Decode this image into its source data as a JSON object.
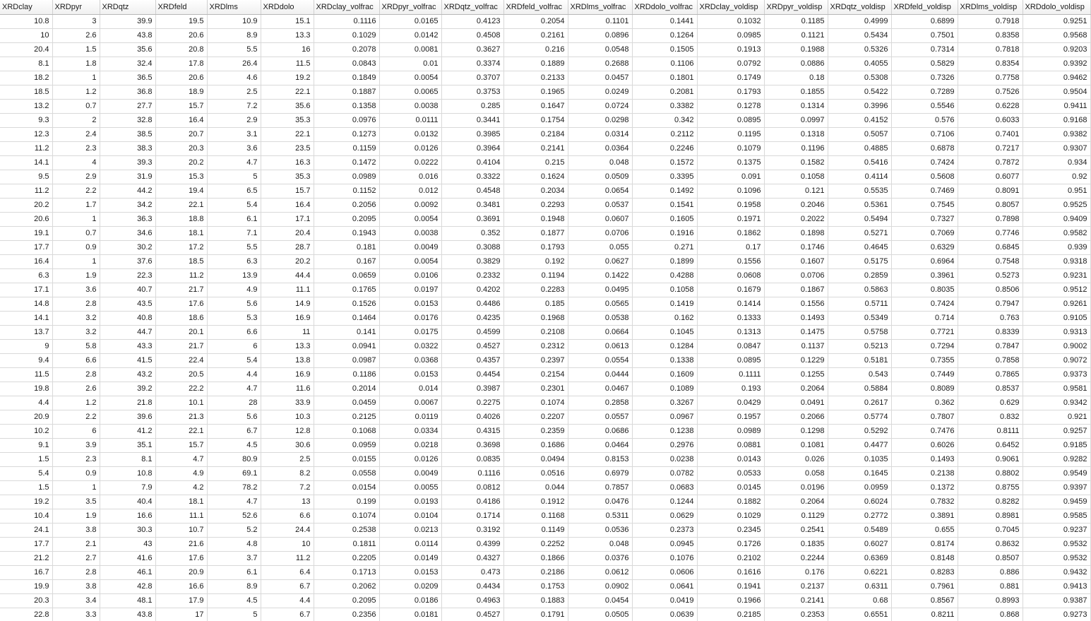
{
  "columns": [
    "XRDclay",
    "XRDpyr",
    "XRDqtz",
    "XRDfeld",
    "XRDlms",
    "XRDdolo",
    "XRDclay_volfrac",
    "XRDpyr_volfrac",
    "XRDqtz_volfrac",
    "XRDfeld_volfrac",
    "XRDlms_volfrac",
    "XRDdolo_volfrac",
    "XRDclay_voldisp",
    "XRDpyr_voldisp",
    "XRDqtz_voldisp",
    "XRDfeld_voldisp",
    "XRDlms_voldisp",
    "XRDdolo_voldisp"
  ],
  "rows": [
    [
      "10.8",
      "3",
      "39.9",
      "19.5",
      "10.9",
      "15.1",
      "0.1116",
      "0.0165",
      "0.4123",
      "0.2054",
      "0.1101",
      "0.1441",
      "0.1032",
      "0.1185",
      "0.4999",
      "0.6899",
      "0.7918",
      "0.9251"
    ],
    [
      "10",
      "2.6",
      "43.8",
      "20.6",
      "8.9",
      "13.3",
      "0.1029",
      "0.0142",
      "0.4508",
      "0.2161",
      "0.0896",
      "0.1264",
      "0.0985",
      "0.1121",
      "0.5434",
      "0.7501",
      "0.8358",
      "0.9568"
    ],
    [
      "20.4",
      "1.5",
      "35.6",
      "20.8",
      "5.5",
      "16",
      "0.2078",
      "0.0081",
      "0.3627",
      "0.216",
      "0.0548",
      "0.1505",
      "0.1913",
      "0.1988",
      "0.5326",
      "0.7314",
      "0.7818",
      "0.9203"
    ],
    [
      "8.1",
      "1.8",
      "32.4",
      "17.8",
      "26.4",
      "11.5",
      "0.0843",
      "0.01",
      "0.3374",
      "0.1889",
      "0.2688",
      "0.1106",
      "0.0792",
      "0.0886",
      "0.4055",
      "0.5829",
      "0.8354",
      "0.9392"
    ],
    [
      "18.2",
      "1",
      "36.5",
      "20.6",
      "4.6",
      "19.2",
      "0.1849",
      "0.0054",
      "0.3707",
      "0.2133",
      "0.0457",
      "0.1801",
      "0.1749",
      "0.18",
      "0.5308",
      "0.7326",
      "0.7758",
      "0.9462"
    ],
    [
      "18.5",
      "1.2",
      "36.8",
      "18.9",
      "2.5",
      "22.1",
      "0.1887",
      "0.0065",
      "0.3753",
      "0.1965",
      "0.0249",
      "0.2081",
      "0.1793",
      "0.1855",
      "0.5422",
      "0.7289",
      "0.7526",
      "0.9504"
    ],
    [
      "13.2",
      "0.7",
      "27.7",
      "15.7",
      "7.2",
      "35.6",
      "0.1358",
      "0.0038",
      "0.285",
      "0.1647",
      "0.0724",
      "0.3382",
      "0.1278",
      "0.1314",
      "0.3996",
      "0.5546",
      "0.6228",
      "0.9411"
    ],
    [
      "9.3",
      "2",
      "32.8",
      "16.4",
      "2.9",
      "35.3",
      "0.0976",
      "0.0111",
      "0.3441",
      "0.1754",
      "0.0298",
      "0.342",
      "0.0895",
      "0.0997",
      "0.4152",
      "0.576",
      "0.6033",
      "0.9168"
    ],
    [
      "12.3",
      "2.4",
      "38.5",
      "20.7",
      "3.1",
      "22.1",
      "0.1273",
      "0.0132",
      "0.3985",
      "0.2184",
      "0.0314",
      "0.2112",
      "0.1195",
      "0.1318",
      "0.5057",
      "0.7106",
      "0.7401",
      "0.9382"
    ],
    [
      "11.2",
      "2.3",
      "38.3",
      "20.3",
      "3.6",
      "23.5",
      "0.1159",
      "0.0126",
      "0.3964",
      "0.2141",
      "0.0364",
      "0.2246",
      "0.1079",
      "0.1196",
      "0.4885",
      "0.6878",
      "0.7217",
      "0.9307"
    ],
    [
      "14.1",
      "4",
      "39.3",
      "20.2",
      "4.7",
      "16.3",
      "0.1472",
      "0.0222",
      "0.4104",
      "0.215",
      "0.048",
      "0.1572",
      "0.1375",
      "0.1582",
      "0.5416",
      "0.7424",
      "0.7872",
      "0.934"
    ],
    [
      "9.5",
      "2.9",
      "31.9",
      "15.3",
      "5",
      "35.3",
      "0.0989",
      "0.016",
      "0.3322",
      "0.1624",
      "0.0509",
      "0.3395",
      "0.091",
      "0.1058",
      "0.4114",
      "0.5608",
      "0.6077",
      "0.92"
    ],
    [
      "11.2",
      "2.2",
      "44.2",
      "19.4",
      "6.5",
      "15.7",
      "0.1152",
      "0.012",
      "0.4548",
      "0.2034",
      "0.0654",
      "0.1492",
      "0.1096",
      "0.121",
      "0.5535",
      "0.7469",
      "0.8091",
      "0.951"
    ],
    [
      "20.2",
      "1.7",
      "34.2",
      "22.1",
      "5.4",
      "16.4",
      "0.2056",
      "0.0092",
      "0.3481",
      "0.2293",
      "0.0537",
      "0.1541",
      "0.1958",
      "0.2046",
      "0.5361",
      "0.7545",
      "0.8057",
      "0.9525"
    ],
    [
      "20.6",
      "1",
      "36.3",
      "18.8",
      "6.1",
      "17.1",
      "0.2095",
      "0.0054",
      "0.3691",
      "0.1948",
      "0.0607",
      "0.1605",
      "0.1971",
      "0.2022",
      "0.5494",
      "0.7327",
      "0.7898",
      "0.9409"
    ],
    [
      "19.1",
      "0.7",
      "34.6",
      "18.1",
      "7.1",
      "20.4",
      "0.1943",
      "0.0038",
      "0.352",
      "0.1877",
      "0.0706",
      "0.1916",
      "0.1862",
      "0.1898",
      "0.5271",
      "0.7069",
      "0.7746",
      "0.9582"
    ],
    [
      "17.7",
      "0.9",
      "30.2",
      "17.2",
      "5.5",
      "28.7",
      "0.181",
      "0.0049",
      "0.3088",
      "0.1793",
      "0.055",
      "0.271",
      "0.17",
      "0.1746",
      "0.4645",
      "0.6329",
      "0.6845",
      "0.939"
    ],
    [
      "16.4",
      "1",
      "37.6",
      "18.5",
      "6.3",
      "20.2",
      "0.167",
      "0.0054",
      "0.3829",
      "0.192",
      "0.0627",
      "0.1899",
      "0.1556",
      "0.1607",
      "0.5175",
      "0.6964",
      "0.7548",
      "0.9318"
    ],
    [
      "6.3",
      "1.9",
      "22.3",
      "11.2",
      "13.9",
      "44.4",
      "0.0659",
      "0.0106",
      "0.2332",
      "0.1194",
      "0.1422",
      "0.4288",
      "0.0608",
      "0.0706",
      "0.2859",
      "0.3961",
      "0.5273",
      "0.9231"
    ],
    [
      "17.1",
      "3.6",
      "40.7",
      "21.7",
      "4.9",
      "11.1",
      "0.1765",
      "0.0197",
      "0.4202",
      "0.2283",
      "0.0495",
      "0.1058",
      "0.1679",
      "0.1867",
      "0.5863",
      "0.8035",
      "0.8506",
      "0.9512"
    ],
    [
      "14.8",
      "2.8",
      "43.5",
      "17.6",
      "5.6",
      "14.9",
      "0.1526",
      "0.0153",
      "0.4486",
      "0.185",
      "0.0565",
      "0.1419",
      "0.1414",
      "0.1556",
      "0.5711",
      "0.7424",
      "0.7947",
      "0.9261"
    ],
    [
      "14.1",
      "3.2",
      "40.8",
      "18.6",
      "5.3",
      "16.9",
      "0.1464",
      "0.0176",
      "0.4235",
      "0.1968",
      "0.0538",
      "0.162",
      "0.1333",
      "0.1493",
      "0.5349",
      "0.714",
      "0.763",
      "0.9105"
    ],
    [
      "13.7",
      "3.2",
      "44.7",
      "20.1",
      "6.6",
      "11",
      "0.141",
      "0.0175",
      "0.4599",
      "0.2108",
      "0.0664",
      "0.1045",
      "0.1313",
      "0.1475",
      "0.5758",
      "0.7721",
      "0.8339",
      "0.9313"
    ],
    [
      "9",
      "5.8",
      "43.3",
      "21.7",
      "6",
      "13.3",
      "0.0941",
      "0.0322",
      "0.4527",
      "0.2312",
      "0.0613",
      "0.1284",
      "0.0847",
      "0.1137",
      "0.5213",
      "0.7294",
      "0.7847",
      "0.9002"
    ],
    [
      "9.4",
      "6.6",
      "41.5",
      "22.4",
      "5.4",
      "13.8",
      "0.0987",
      "0.0368",
      "0.4357",
      "0.2397",
      "0.0554",
      "0.1338",
      "0.0895",
      "0.1229",
      "0.5181",
      "0.7355",
      "0.7858",
      "0.9072"
    ],
    [
      "11.5",
      "2.8",
      "43.2",
      "20.5",
      "4.4",
      "16.9",
      "0.1186",
      "0.0153",
      "0.4454",
      "0.2154",
      "0.0444",
      "0.1609",
      "0.1111",
      "0.1255",
      "0.543",
      "0.7449",
      "0.7865",
      "0.9373"
    ],
    [
      "19.8",
      "2.6",
      "39.2",
      "22.2",
      "4.7",
      "11.6",
      "0.2014",
      "0.014",
      "0.3987",
      "0.2301",
      "0.0467",
      "0.1089",
      "0.193",
      "0.2064",
      "0.5884",
      "0.8089",
      "0.8537",
      "0.9581"
    ],
    [
      "4.4",
      "1.2",
      "21.8",
      "10.1",
      "28",
      "33.9",
      "0.0459",
      "0.0067",
      "0.2275",
      "0.1074",
      "0.2858",
      "0.3267",
      "0.0429",
      "0.0491",
      "0.2617",
      "0.362",
      "0.629",
      "0.9342"
    ],
    [
      "20.9",
      "2.2",
      "39.6",
      "21.3",
      "5.6",
      "10.3",
      "0.2125",
      "0.0119",
      "0.4026",
      "0.2207",
      "0.0557",
      "0.0967",
      "0.1957",
      "0.2066",
      "0.5774",
      "0.7807",
      "0.832",
      "0.921"
    ],
    [
      "10.2",
      "6",
      "41.2",
      "22.1",
      "6.7",
      "12.8",
      "0.1068",
      "0.0334",
      "0.4315",
      "0.2359",
      "0.0686",
      "0.1238",
      "0.0989",
      "0.1298",
      "0.5292",
      "0.7476",
      "0.8111",
      "0.9257"
    ],
    [
      "9.1",
      "3.9",
      "35.1",
      "15.7",
      "4.5",
      "30.6",
      "0.0959",
      "0.0218",
      "0.3698",
      "0.1686",
      "0.0464",
      "0.2976",
      "0.0881",
      "0.1081",
      "0.4477",
      "0.6026",
      "0.6452",
      "0.9185"
    ],
    [
      "1.5",
      "2.3",
      "8.1",
      "4.7",
      "80.9",
      "2.5",
      "0.0155",
      "0.0126",
      "0.0835",
      "0.0494",
      "0.8153",
      "0.0238",
      "0.0143",
      "0.026",
      "0.1035",
      "0.1493",
      "0.9061",
      "0.9282"
    ],
    [
      "5.4",
      "0.9",
      "10.8",
      "4.9",
      "69.1",
      "8.2",
      "0.0558",
      "0.0049",
      "0.1116",
      "0.0516",
      "0.6979",
      "0.0782",
      "0.0533",
      "0.058",
      "0.1645",
      "0.2138",
      "0.8802",
      "0.9549"
    ],
    [
      "1.5",
      "1",
      "7.9",
      "4.2",
      "78.2",
      "7.2",
      "0.0154",
      "0.0055",
      "0.0812",
      "0.044",
      "0.7857",
      "0.0683",
      "0.0145",
      "0.0196",
      "0.0959",
      "0.1372",
      "0.8755",
      "0.9397"
    ],
    [
      "19.2",
      "3.5",
      "40.4",
      "18.1",
      "4.7",
      "13",
      "0.199",
      "0.0193",
      "0.4186",
      "0.1912",
      "0.0476",
      "0.1244",
      "0.1882",
      "0.2064",
      "0.6024",
      "0.7832",
      "0.8282",
      "0.9459"
    ],
    [
      "10.4",
      "1.9",
      "16.6",
      "11.1",
      "52.6",
      "6.6",
      "0.1074",
      "0.0104",
      "0.1714",
      "0.1168",
      "0.5311",
      "0.0629",
      "0.1029",
      "0.1129",
      "0.2772",
      "0.3891",
      "0.8981",
      "0.9585"
    ],
    [
      "24.1",
      "3.8",
      "30.3",
      "10.7",
      "5.2",
      "24.4",
      "0.2538",
      "0.0213",
      "0.3192",
      "0.1149",
      "0.0536",
      "0.2373",
      "0.2345",
      "0.2541",
      "0.5489",
      "0.655",
      "0.7045",
      "0.9237"
    ],
    [
      "17.7",
      "2.1",
      "43",
      "21.6",
      "4.8",
      "10",
      "0.1811",
      "0.0114",
      "0.4399",
      "0.2252",
      "0.048",
      "0.0945",
      "0.1726",
      "0.1835",
      "0.6027",
      "0.8174",
      "0.8632",
      "0.9532"
    ],
    [
      "21.2",
      "2.7",
      "41.6",
      "17.6",
      "3.7",
      "11.2",
      "0.2205",
      "0.0149",
      "0.4327",
      "0.1866",
      "0.0376",
      "0.1076",
      "0.2102",
      "0.2244",
      "0.6369",
      "0.8148",
      "0.8507",
      "0.9532"
    ],
    [
      "16.7",
      "2.8",
      "46.1",
      "20.9",
      "6.1",
      "6.4",
      "0.1713",
      "0.0153",
      "0.473",
      "0.2186",
      "0.0612",
      "0.0606",
      "0.1616",
      "0.176",
      "0.6221",
      "0.8283",
      "0.886",
      "0.9432"
    ],
    [
      "19.9",
      "3.8",
      "42.8",
      "16.6",
      "8.9",
      "6.7",
      "0.2062",
      "0.0209",
      "0.4434",
      "0.1753",
      "0.0902",
      "0.0641",
      "0.1941",
      "0.2137",
      "0.6311",
      "0.7961",
      "0.881",
      "0.9413"
    ],
    [
      "20.3",
      "3.4",
      "48.1",
      "17.9",
      "4.5",
      "4.4",
      "0.2095",
      "0.0186",
      "0.4963",
      "0.1883",
      "0.0454",
      "0.0419",
      "0.1966",
      "0.2141",
      "0.68",
      "0.8567",
      "0.8993",
      "0.9387"
    ],
    [
      "22.8",
      "3.3",
      "43.8",
      "17",
      "5",
      "6.7",
      "0.2356",
      "0.0181",
      "0.4527",
      "0.1791",
      "0.0505",
      "0.0639",
      "0.2185",
      "0.2353",
      "0.6551",
      "0.8211",
      "0.868",
      "0.9273"
    ]
  ]
}
